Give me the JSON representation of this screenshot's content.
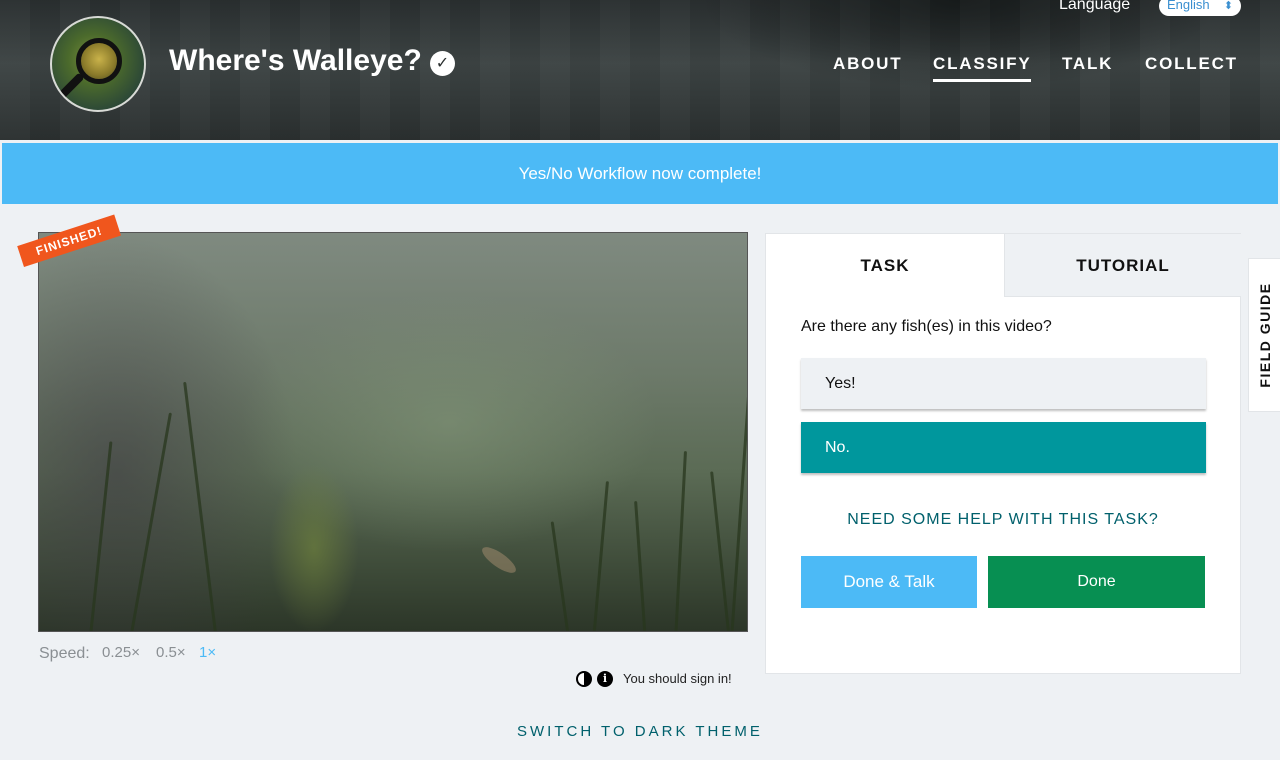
{
  "header": {
    "project_title": "Where's Walleye?",
    "language_label": "Language",
    "language_value": "English",
    "nav": [
      {
        "label": "ABOUT",
        "active": false
      },
      {
        "label": "CLASSIFY",
        "active": true
      },
      {
        "label": "TALK",
        "active": false
      },
      {
        "label": "COLLECT",
        "active": false
      }
    ]
  },
  "banner": {
    "text": "Yes/No Workflow now complete!"
  },
  "subject": {
    "badge": "FINISHED!",
    "speed_label": "Speed:",
    "speeds": [
      {
        "label": "0.25×",
        "active": false
      },
      {
        "label": "0.5×",
        "active": false
      },
      {
        "label": "1×",
        "active": true
      }
    ],
    "sign_in_text": "You should sign in!"
  },
  "task_panel": {
    "tabs": [
      {
        "label": "TASK",
        "active": true
      },
      {
        "label": "TUTORIAL",
        "active": false
      }
    ],
    "question": "Are there any fish(es) in this video?",
    "answers": [
      {
        "label": "Yes!",
        "selected": false
      },
      {
        "label": "No.",
        "selected": true
      }
    ],
    "help_link": "NEED SOME HELP WITH THIS TASK?",
    "done_talk_label": "Done & Talk",
    "done_label": "Done"
  },
  "field_guide": {
    "label": "FIELD GUIDE"
  },
  "footer": {
    "theme_toggle": "SWITCH TO DARK THEME"
  },
  "colors": {
    "banner": "#4cbaf6",
    "selected_answer": "#00979d",
    "done": "#078f52",
    "done_talk": "#4cbaf6",
    "finished_badge": "#f0561d",
    "link_teal": "#00606c"
  },
  "icons": [
    "check-circle-icon",
    "contrast-icon",
    "info-icon",
    "chevron-updown-icon"
  ]
}
